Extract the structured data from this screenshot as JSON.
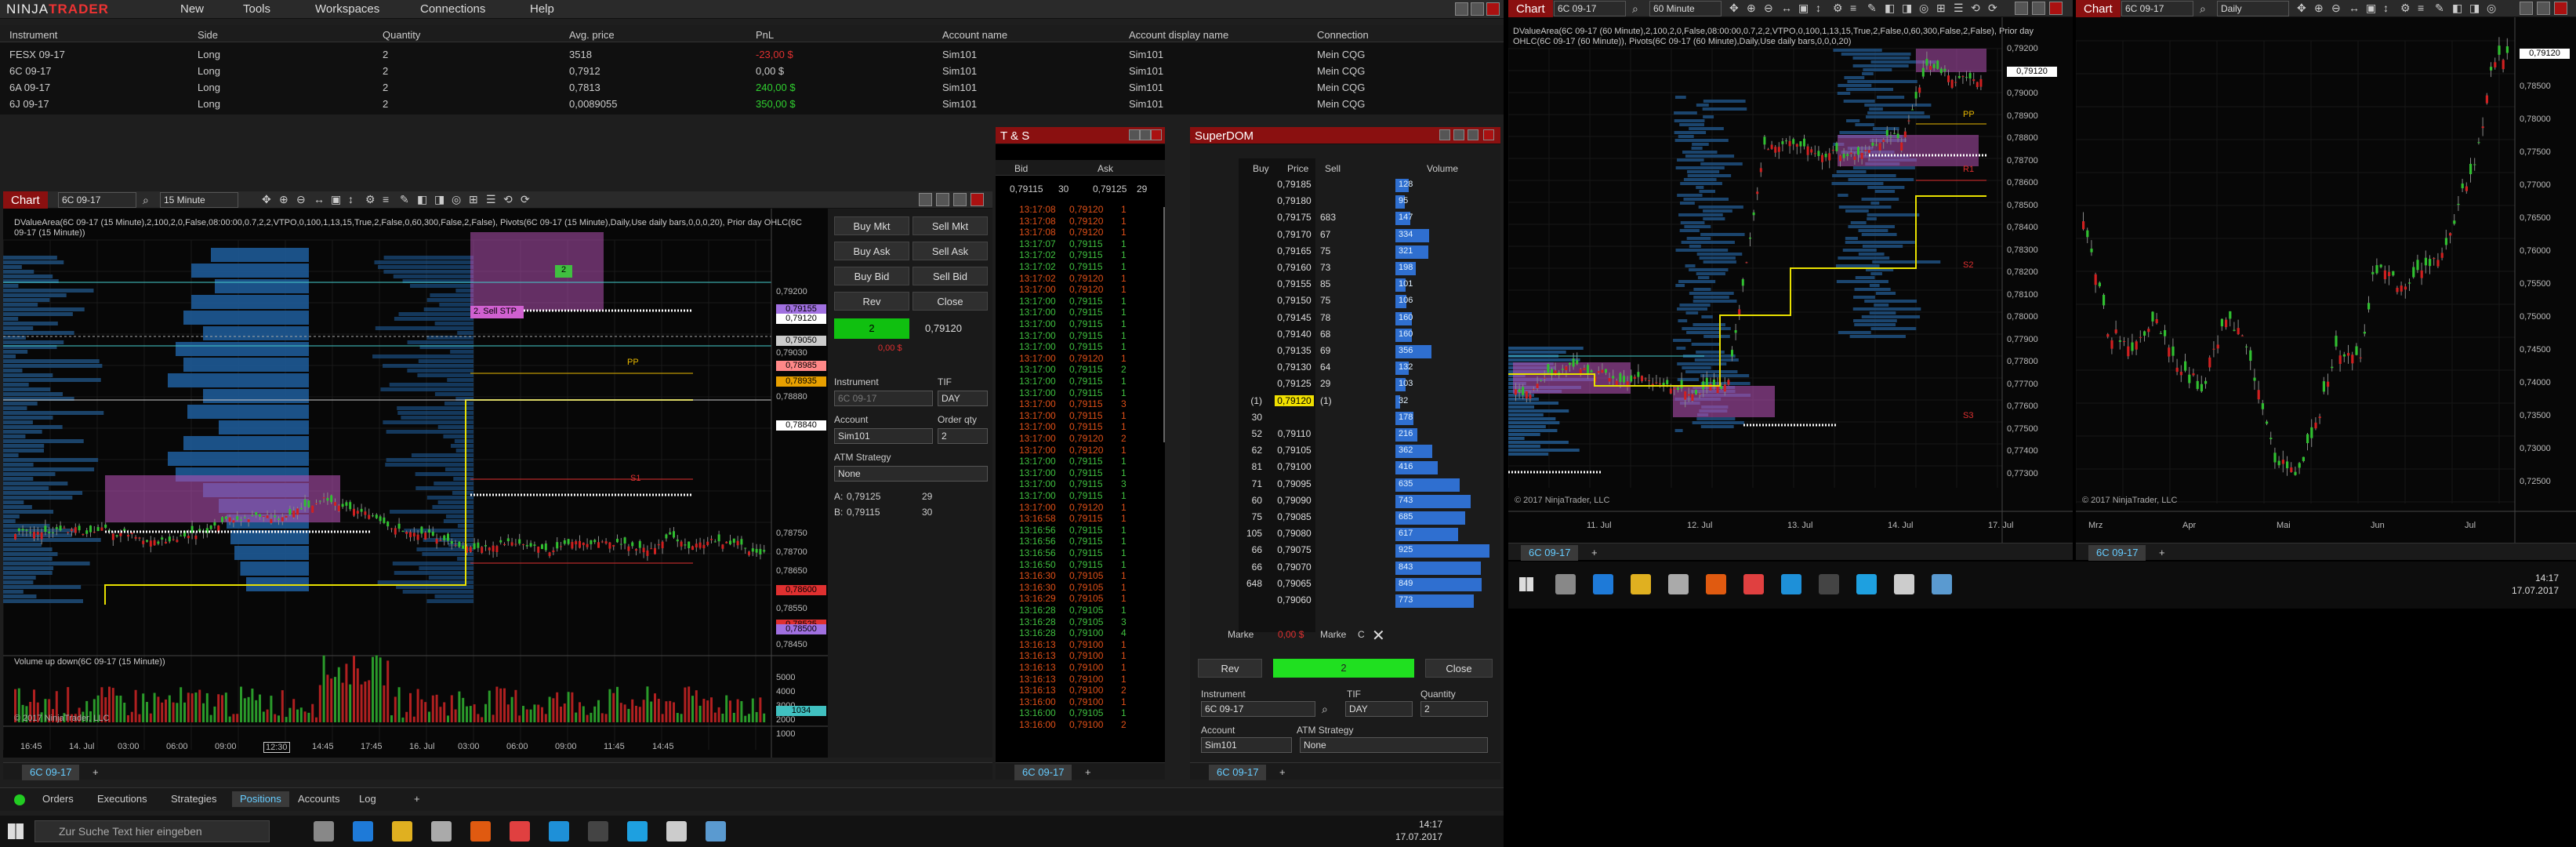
{
  "app": {
    "logo_left": "NINJA",
    "logo_right": "TRADER"
  },
  "menu": [
    "New",
    "Tools",
    "Workspaces",
    "Connections",
    "Help"
  ],
  "positions": {
    "headers": [
      "Instrument",
      "Side",
      "Quantity",
      "Avg. price",
      "PnL",
      "Account name",
      "Account display name",
      "Connection"
    ],
    "rows": [
      [
        "FESX 09-17",
        "Long",
        "2",
        "3518",
        "-23,00 $",
        "Sim101",
        "Sim101",
        "Mein CQG"
      ],
      [
        "6C 09-17",
        "Long",
        "2",
        "0,7912",
        "0,00 $",
        "Sim101",
        "Sim101",
        "Mein CQG"
      ],
      [
        "6A 09-17",
        "Long",
        "2",
        "0,7813",
        "240,00 $",
        "Sim101",
        "Sim101",
        "Mein CQG"
      ],
      [
        "6J 09-17",
        "Long",
        "2",
        "0,0089055",
        "350,00 $",
        "Sim101",
        "Sim101",
        "Mein CQG"
      ]
    ]
  },
  "chart1": {
    "title": "Chart",
    "instrument": "6C 09-17",
    "interval": "15 Minute",
    "indicator_text": "DValueArea(6C 09-17 (15 Minute),2,100,2,0,False,08:00:00,0.7,2,2,VTPO,0,100,1,13,15,True,2,False,0,60,300,False,2,False), Pivots(6C 09-17 (15 Minute),Daily,Use daily bars,0,0,0,20), Prior day OHLC(6C",
    "indicator_text2": "09-17 (15 Minute))",
    "volume_label": "Volume up down(6C 09-17 (15 Minute))",
    "copyright": "© 2017 NinjaTrader, LLC",
    "order_label": "2. Sell STP",
    "order_qty_tag": "2",
    "pp_label": "PP",
    "s1_label": "S1",
    "price_ticks": [
      "0,79200",
      "0,79155",
      "0,79120",
      "0,79050",
      "0,79030",
      "0,78985",
      "0,78935",
      "0,78880",
      "0,78840",
      "0,78750",
      "0,78700",
      "0,78650",
      "0,78600",
      "0,78550",
      "0,78525",
      "0,78500",
      "0,78450"
    ],
    "vol_ticks": [
      "5000",
      "4000",
      "3000",
      "2000",
      "1000",
      "1034"
    ],
    "time_ticks": [
      "16:45",
      "14. Jul",
      "03:00",
      "06:00",
      "09:00",
      "12:30",
      "14:45",
      "17:45",
      "16. Jul",
      "03:00",
      "06:00",
      "09:00",
      "11:45",
      "14:45"
    ],
    "tab": "6C 09-17"
  },
  "chart_trader": {
    "buy_mkt": "Buy Mkt",
    "sell_mkt": "Sell Mkt",
    "buy_ask": "Buy Ask",
    "sell_ask": "Sell Ask",
    "buy_bid": "Buy Bid",
    "sell_bid": "Sell Bid",
    "rev": "Rev",
    "close": "Close",
    "position_qty": "2",
    "position_price": "0,79120",
    "position_pnl": "0,00 $",
    "instrument_label": "Instrument",
    "tif_label": "TIF",
    "instrument_value": "6C 09-17",
    "tif_value": "DAY",
    "account_label": "Account",
    "order_qty_label": "Order qty",
    "account_value": "Sim101",
    "order_qty_value": "2",
    "atm_label": "ATM Strategy",
    "atm_value": "None",
    "ask_line": "A:",
    "ask_price": "0,79125",
    "ask_size": "29",
    "bid_line": "B:",
    "bid_price": "0,79115",
    "bid_size": "30"
  },
  "tns": {
    "title": "T & S",
    "header_bid": "Bid",
    "header_ask": "Ask",
    "bid": "0,79115",
    "bid_size": "30",
    "ask": "0,79125",
    "ask_size": "29",
    "tab": "6C 09-17",
    "rows": [
      [
        "13:17:08",
        "0,79120",
        "1",
        "r"
      ],
      [
        "13:17:08",
        "0,79120",
        "1",
        "r"
      ],
      [
        "13:17:08",
        "0,79120",
        "1",
        "r"
      ],
      [
        "13:17:07",
        "0,79115",
        "1",
        "g"
      ],
      [
        "13:17:02",
        "0,79115",
        "1",
        "g"
      ],
      [
        "13:17:02",
        "0,79115",
        "1",
        "g"
      ],
      [
        "13:17:02",
        "0,79120",
        "1",
        "r"
      ],
      [
        "13:17:00",
        "0,79120",
        "1",
        "r"
      ],
      [
        "13:17:00",
        "0,79115",
        "1",
        "g"
      ],
      [
        "13:17:00",
        "0,79115",
        "1",
        "g"
      ],
      [
        "13:17:00",
        "0,79115",
        "1",
        "g"
      ],
      [
        "13:17:00",
        "0,79115",
        "1",
        "g"
      ],
      [
        "13:17:00",
        "0,79115",
        "1",
        "g"
      ],
      [
        "13:17:00",
        "0,79120",
        "1",
        "r"
      ],
      [
        "13:17:00",
        "0,79115",
        "2",
        "g"
      ],
      [
        "13:17:00",
        "0,79115",
        "1",
        "g"
      ],
      [
        "13:17:00",
        "0,79115",
        "1",
        "g"
      ],
      [
        "13:17:00",
        "0,79115",
        "3",
        "r"
      ],
      [
        "13:17:00",
        "0,79115",
        "1",
        "r"
      ],
      [
        "13:17:00",
        "0,79115",
        "1",
        "r"
      ],
      [
        "13:17:00",
        "0,79120",
        "2",
        "r"
      ],
      [
        "13:17:00",
        "0,79120",
        "1",
        "r"
      ],
      [
        "13:17:00",
        "0,79115",
        "1",
        "g"
      ],
      [
        "13:17:00",
        "0,79115",
        "1",
        "g"
      ],
      [
        "13:17:00",
        "0,79115",
        "3",
        "g"
      ],
      [
        "13:17:00",
        "0,79115",
        "1",
        "g"
      ],
      [
        "13:17:00",
        "0,79120",
        "1",
        "r"
      ],
      [
        "13:16:58",
        "0,79115",
        "1",
        "r"
      ],
      [
        "13:16:56",
        "0,79115",
        "1",
        "g"
      ],
      [
        "13:16:56",
        "0,79115",
        "1",
        "g"
      ],
      [
        "13:16:56",
        "0,79115",
        "1",
        "g"
      ],
      [
        "13:16:50",
        "0,79115",
        "1",
        "g"
      ],
      [
        "13:16:30",
        "0,79105",
        "1",
        "r"
      ],
      [
        "13:16:30",
        "0,79105",
        "1",
        "r"
      ],
      [
        "13:16:29",
        "0,79105",
        "1",
        "r"
      ],
      [
        "13:16:28",
        "0,79105",
        "1",
        "g"
      ],
      [
        "13:16:28",
        "0,79105",
        "3",
        "g"
      ],
      [
        "13:16:28",
        "0,79100",
        "4",
        "g"
      ],
      [
        "13:16:13",
        "0,79100",
        "1",
        "r"
      ],
      [
        "13:16:13",
        "0,79100",
        "1",
        "r"
      ],
      [
        "13:16:13",
        "0,79100",
        "1",
        "r"
      ],
      [
        "13:16:13",
        "0,79100",
        "1",
        "r"
      ],
      [
        "13:16:13",
        "0,79100",
        "2",
        "r"
      ],
      [
        "13:16:00",
        "0,79100",
        "1",
        "r"
      ],
      [
        "13:16:00",
        "0,79105",
        "1",
        "g"
      ],
      [
        "13:16:00",
        "0,79100",
        "2",
        "r"
      ]
    ]
  },
  "superdom": {
    "title": "SuperDOM",
    "headers": [
      "Buy",
      "Price",
      "Sell",
      "Volume"
    ],
    "rows": [
      [
        "",
        "0,79185",
        "",
        "128"
      ],
      [
        "",
        "0,79180",
        "",
        "95"
      ],
      [
        "",
        "0,79175",
        "683",
        "147"
      ],
      [
        "",
        "0,79170",
        "67",
        "334"
      ],
      [
        "",
        "0,79165",
        "75",
        "321"
      ],
      [
        "",
        "0,79160",
        "73",
        "198"
      ],
      [
        "",
        "0,79155",
        "85",
        "101"
      ],
      [
        "",
        "0,79150",
        "75",
        "106"
      ],
      [
        "",
        "0,79145",
        "78",
        "160"
      ],
      [
        "",
        "0,79140",
        "68",
        "160"
      ],
      [
        "",
        "0,79135",
        "69",
        "356"
      ],
      [
        "",
        "0,79130",
        "64",
        "132"
      ],
      [
        "",
        "0,79125",
        "29",
        "103"
      ],
      [
        "(1)",
        "0,79120",
        "(1)",
        "32"
      ],
      [
        "30",
        "",
        "",
        "178"
      ],
      [
        "52",
        "0,79110",
        "",
        "216"
      ],
      [
        "62",
        "0,79105",
        "",
        "362"
      ],
      [
        "81",
        "0,79100",
        "",
        "416"
      ],
      [
        "71",
        "0,79095",
        "",
        "635"
      ],
      [
        "60",
        "0,79090",
        "",
        "743"
      ],
      [
        "75",
        "0,79085",
        "",
        "685"
      ],
      [
        "105",
        "0,79080",
        "",
        "617"
      ],
      [
        "66",
        "0,79075",
        "",
        "925"
      ],
      [
        "66",
        "0,79070",
        "",
        "843"
      ],
      [
        "648",
        "0,79065",
        "",
        "849"
      ],
      [
        "",
        "0,79060",
        "",
        "773"
      ]
    ],
    "market_left": "Marke",
    "pnl": "0,00 $",
    "market_right": "Marke",
    "c": "C",
    "rev": "Rev",
    "qty": "2",
    "close": "Close",
    "instrument_label": "Instrument",
    "tif_label": "TIF",
    "quantity_label": "Quantity",
    "instrument_value": "6C 09-17",
    "tif_value": "DAY",
    "quantity_value": "2",
    "account_label": "Account",
    "atm_label": "ATM Strategy",
    "account_value": "Sim101",
    "atm_value": "None",
    "tab": "6C 09-17"
  },
  "bottom_tabs": [
    "Orders",
    "Executions",
    "Strategies",
    "Positions",
    "Accounts",
    "Log"
  ],
  "taskbar_left": {
    "search": "Zur Suche Text hier eingeben",
    "time": "14:17",
    "date": "17.07.2017"
  },
  "chart2": {
    "title": "Chart",
    "instrument": "6C 09-17",
    "interval": "60 Minute",
    "indicator_text": "DValueArea(6C 09-17 (60 Minute),2,100,2,0,False,08:00:00,0.7,2,2,VTPO,0,100,1,13,15,True,2,False,0,60,300,False,2,False), Prior day",
    "indicator_text2": "OHLC(6C 09-17 (60 Minute)), Pivots(6C 09-17 (60 Minute),Daily,Use daily bars,0,0,0,20)",
    "copyright": "© 2017 NinjaTrader, LLC",
    "price_ticks": [
      "0,79200",
      "0,79120",
      "0,79000",
      "0,78900",
      "0,78800",
      "0,78700",
      "0,78600",
      "0,78500",
      "0,78400",
      "0,78300",
      "0,78200",
      "0,78100",
      "0,78000",
      "0,77900",
      "0,77800",
      "0,77700",
      "0,77600",
      "0,77500",
      "0,77400",
      "0,77300"
    ],
    "time_ticks": [
      "11. Jul",
      "12. Jul",
      "13. Jul",
      "14. Jul",
      "17. Jul"
    ],
    "pp": "PP",
    "r1": "R1",
    "s1": "S1",
    "s2": "S2",
    "s3": "S3",
    "tab": "6C 09-17"
  },
  "chart3": {
    "title": "Chart",
    "instrument": "6C 09-17",
    "interval": "Daily",
    "copyright": "© 2017 NinjaTrader, LLC",
    "price_ticks": [
      "0,79120",
      "0,78500",
      "0,78000",
      "0,77500",
      "0,77000",
      "0,76500",
      "0,76000",
      "0,75500",
      "0,75000",
      "0,74500",
      "0,74000",
      "0,73500",
      "0,73000",
      "0,72500"
    ],
    "time_ticks": [
      "Mrz",
      "Apr",
      "Mai",
      "Jun",
      "Jul"
    ],
    "tab": "6C 09-17"
  },
  "taskbar_right": {
    "time": "14:17",
    "date": "17.07.2017"
  }
}
